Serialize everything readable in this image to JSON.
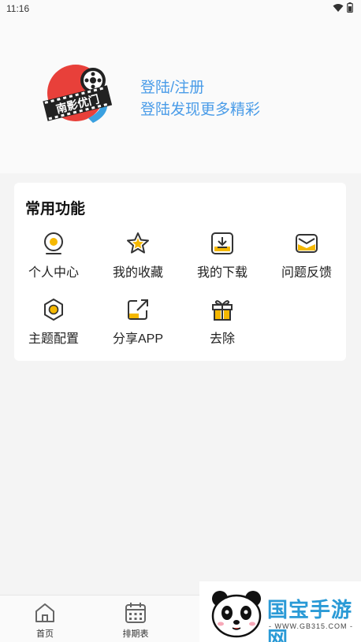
{
  "status_bar": {
    "time": "11:16"
  },
  "header": {
    "logo_text": "南影优门",
    "login_label": "登陆/注册",
    "login_subtitle": "登陆发现更多精彩"
  },
  "functions": {
    "title": "常用功能",
    "items": [
      {
        "label": "个人中心",
        "icon": "user-icon"
      },
      {
        "label": "我的收藏",
        "icon": "star-icon"
      },
      {
        "label": "我的下载",
        "icon": "download-icon"
      },
      {
        "label": "问题反馈",
        "icon": "mail-icon"
      },
      {
        "label": "主题配置",
        "icon": "theme-icon"
      },
      {
        "label": "分享APP",
        "icon": "share-icon"
      },
      {
        "label": "去除",
        "icon": "gift-icon"
      }
    ]
  },
  "bottom_nav": {
    "items": [
      {
        "label": "首页",
        "icon": "home-icon"
      },
      {
        "label": "排期表",
        "icon": "calendar-icon"
      }
    ]
  },
  "watermark": {
    "brand": "国宝手游网",
    "url": "- WWW.GB315.COM -"
  },
  "colors": {
    "accent": "#4a9ce8",
    "icon_yellow": "#f5b800",
    "icon_stroke": "#333333"
  }
}
